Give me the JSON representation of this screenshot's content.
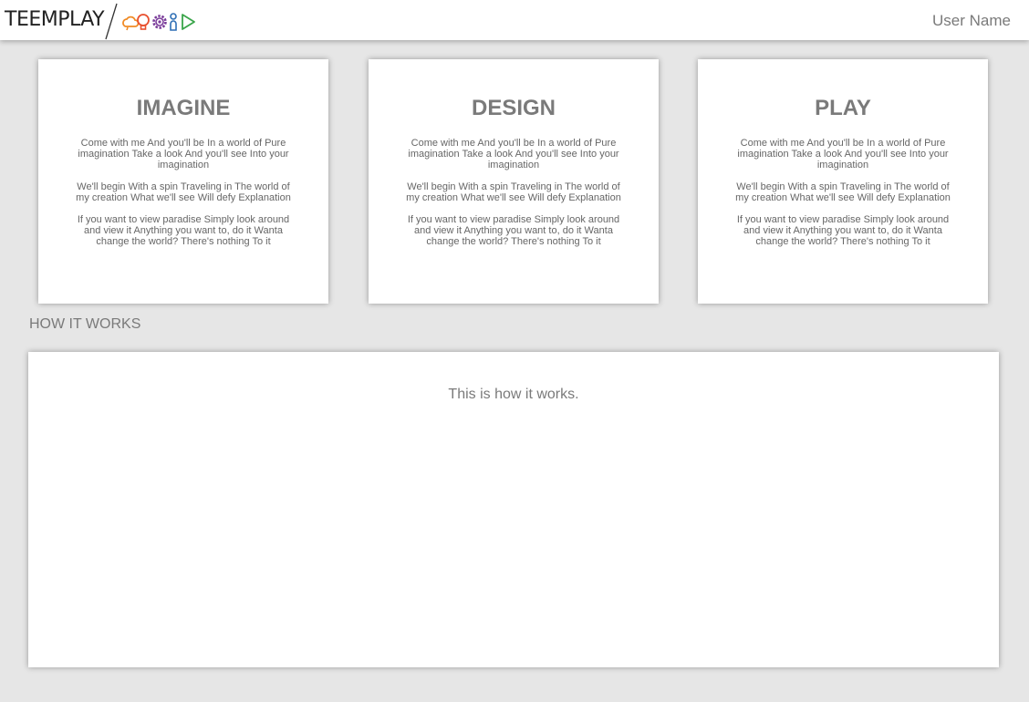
{
  "header": {
    "brand": "TEEMPLAY",
    "user_name": "User Name",
    "logo_icons": [
      "cloud-icon",
      "lightbulb-icon",
      "gear-icon",
      "pawn-icon",
      "play-icon"
    ]
  },
  "cards": [
    {
      "title": "IMAGINE",
      "paragraphs": [
        "Come with me And you'll be In a world of Pure imagination Take a look And you'll see Into your imagination",
        "We'll begin With a spin Traveling in The world of my creation What we'll see Will defy Explanation",
        "If you want to view paradise Simply look around and view it Anything you want to, do it Wanta change the world? There's nothing To it"
      ]
    },
    {
      "title": "DESIGN",
      "paragraphs": [
        "Come with me And you'll be In a world of Pure imagination Take a look And you'll see Into your imagination",
        "We'll begin With a spin Traveling in The world of my creation What we'll see Will defy Explanation",
        "If you want to view paradise Simply look around and view it Anything you want to, do it Wanta change the world? There's nothing To it"
      ]
    },
    {
      "title": "PLAY",
      "paragraphs": [
        "Come with me And you'll be In a world of Pure imagination Take a look And you'll see Into your imagination",
        "We'll begin With a spin Traveling in The world of my creation What we'll see Will defy Explanation",
        "If you want to view paradise Simply look around and view it Anything you want to, do it Wanta change the world? There's nothing To it"
      ]
    }
  ],
  "how_it_works": {
    "label": "HOW IT WORKS",
    "text": "This is how it works."
  },
  "colors": {
    "background": "#e6e6e6",
    "card": "#ffffff",
    "heading": "#7a7a7a",
    "logo_orange": "#f08a24",
    "logo_red": "#e8502f",
    "logo_purple": "#7a3c9a",
    "logo_blue": "#2f6fb5",
    "logo_green": "#3aa54a"
  }
}
